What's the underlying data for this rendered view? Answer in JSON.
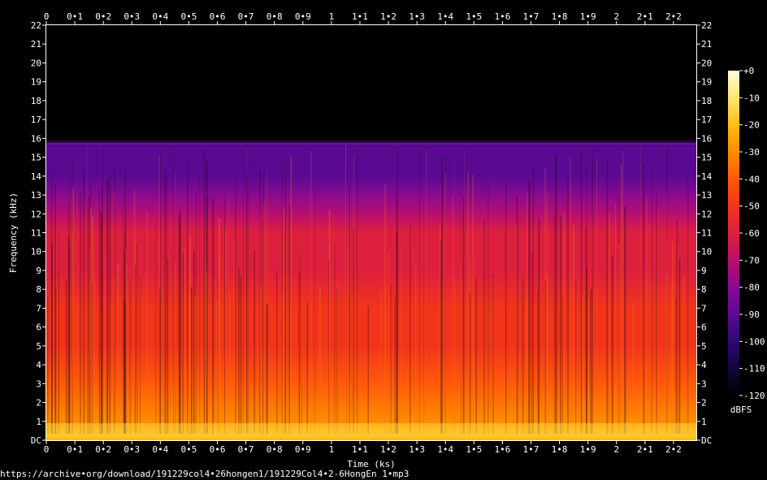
{
  "chart_data": {
    "type": "heatmap",
    "title": "",
    "xlabel": "Time (ks)",
    "ylabel": "Frequency (kHz)",
    "x_ticks": [
      "0",
      "0•1",
      "0•2",
      "0•3",
      "0•4",
      "0•5",
      "0•6",
      "0•7",
      "0•8",
      "0•9",
      "1",
      "1•1",
      "1•2",
      "1•3",
      "1•4",
      "1•5",
      "1•6",
      "1•7",
      "1•8",
      "1•9",
      "2",
      "2•1",
      "2•2"
    ],
    "y_ticks": [
      "DC",
      "1",
      "2",
      "3",
      "4",
      "5",
      "6",
      "7",
      "8",
      "9",
      "10",
      "11",
      "12",
      "13",
      "14",
      "15",
      "16",
      "17",
      "18",
      "19",
      "20",
      "21",
      "22"
    ],
    "xlim": [
      0,
      2.28
    ],
    "ylim": [
      0,
      22
    ],
    "colorbar": {
      "label": "dBFS",
      "range": [
        -120,
        0
      ],
      "ticks": [
        "+0",
        "-10",
        "-20",
        "-30",
        "-40",
        "-50",
        "-60",
        "-70",
        "-80",
        "-90",
        "-100",
        "-110",
        "-120"
      ],
      "colors": [
        "#000000",
        "#10063a",
        "#2c0a73",
        "#5a0a92",
        "#8a0a8f",
        "#b80f6e",
        "#dd1f3e",
        "#f2341b",
        "#ff5a0a",
        "#ff8c00",
        "#ffbd14",
        "#ffe56e",
        "#ffffd8"
      ]
    },
    "spectral_profile": [
      {
        "freq_khz": 0.3,
        "dbfs": -20
      },
      {
        "freq_khz": 1,
        "dbfs": -32
      },
      {
        "freq_khz": 3,
        "dbfs": -42
      },
      {
        "freq_khz": 5,
        "dbfs": -48
      },
      {
        "freq_khz": 7,
        "dbfs": -52
      },
      {
        "freq_khz": 9,
        "dbfs": -56
      },
      {
        "freq_khz": 11,
        "dbfs": -62
      },
      {
        "freq_khz": 12,
        "dbfs": -70
      },
      {
        "freq_khz": 13,
        "dbfs": -82
      },
      {
        "freq_khz": 14,
        "dbfs": -95
      },
      {
        "freq_khz": 15.6,
        "dbfs": -88
      },
      {
        "freq_khz": 16,
        "dbfs": -118
      },
      {
        "freq_khz": 22,
        "dbfs": -120
      }
    ],
    "cutoff_khz": 15.8
  },
  "footer": {
    "source_url": "https://archive•org/download/191229col4•26hongen1/191229Col4•2-6HongEn 1•mp3"
  }
}
